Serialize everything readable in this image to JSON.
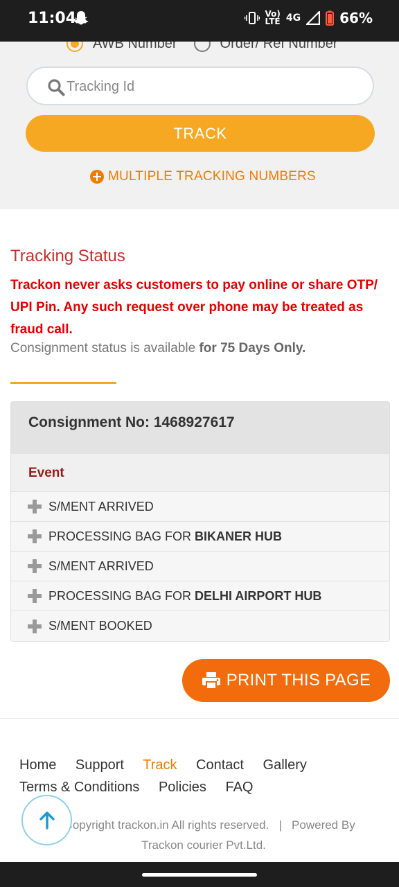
{
  "status_bar": {
    "time": "11:04",
    "network_top": "Vo)",
    "network_bottom": "LTE",
    "network_type": "4G",
    "battery": "66%"
  },
  "form": {
    "radio_awb": "AWB Number",
    "radio_order": "Order/ Ref Number",
    "search_placeholder": "Tracking Id",
    "track_label": "TRACK",
    "multiple_label": "MULTIPLE TRACKING NUMBERS"
  },
  "tracking": {
    "title": "Tracking Status",
    "warning": "Trackon never asks customers to pay online or share OTP/ UPI Pin. Any such request over phone may be treated as fraud call.",
    "availability_prefix": "Consignment status is available ",
    "availability_bold": "for 75 Days Only."
  },
  "table": {
    "consignment": "Consignment No: 1468927617",
    "event_header": "Event",
    "rows": [
      {
        "text": "S/MENT ARRIVED",
        "bold": ""
      },
      {
        "text": "PROCESSING BAG FOR",
        "bold": "BIKANER HUB"
      },
      {
        "text": "S/MENT ARRIVED",
        "bold": ""
      },
      {
        "text": "PROCESSING BAG FOR",
        "bold": "DELHI AIRPORT HUB"
      },
      {
        "text": "S/MENT BOOKED",
        "bold": ""
      }
    ]
  },
  "print_label": "PRINT THIS PAGE",
  "footer": {
    "nav": [
      "Home",
      "Support",
      "Track",
      "Contact",
      "Gallery"
    ],
    "nav2": [
      "Terms & Conditions",
      "Policies",
      "FAQ"
    ],
    "copyright_line1": "© Copyright trackon.in All rights reserved.   |   Powered By",
    "copyright_line2": "Trackon courier Pvt.Ltd."
  },
  "colors": {
    "accent_yellow": "#f7a823",
    "accent_orange": "#f26c0d",
    "warning_red": "#e40000",
    "title_red": "#c9302c"
  }
}
